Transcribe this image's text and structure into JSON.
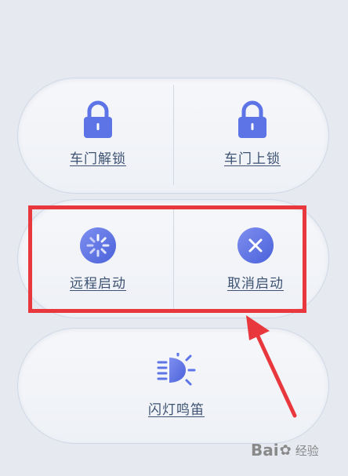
{
  "controls": {
    "unlock_label": "车门解锁",
    "lock_label": "车门上锁",
    "remote_start_label": "远程启动",
    "cancel_start_label": "取消启动",
    "flash_honk_label": "闪灯鸣笛"
  },
  "icons": {
    "unlock": "lock-icon",
    "lock": "lock-icon",
    "remote_start": "loading-spinner-icon",
    "cancel_start": "close-icon",
    "flash_honk": "headlight-icon"
  },
  "watermark": {
    "brand": "Bai",
    "text": "经验"
  },
  "colors": {
    "icon_blue": "#5c74e6",
    "label": "#3d5272",
    "highlight": "#e8383d"
  }
}
